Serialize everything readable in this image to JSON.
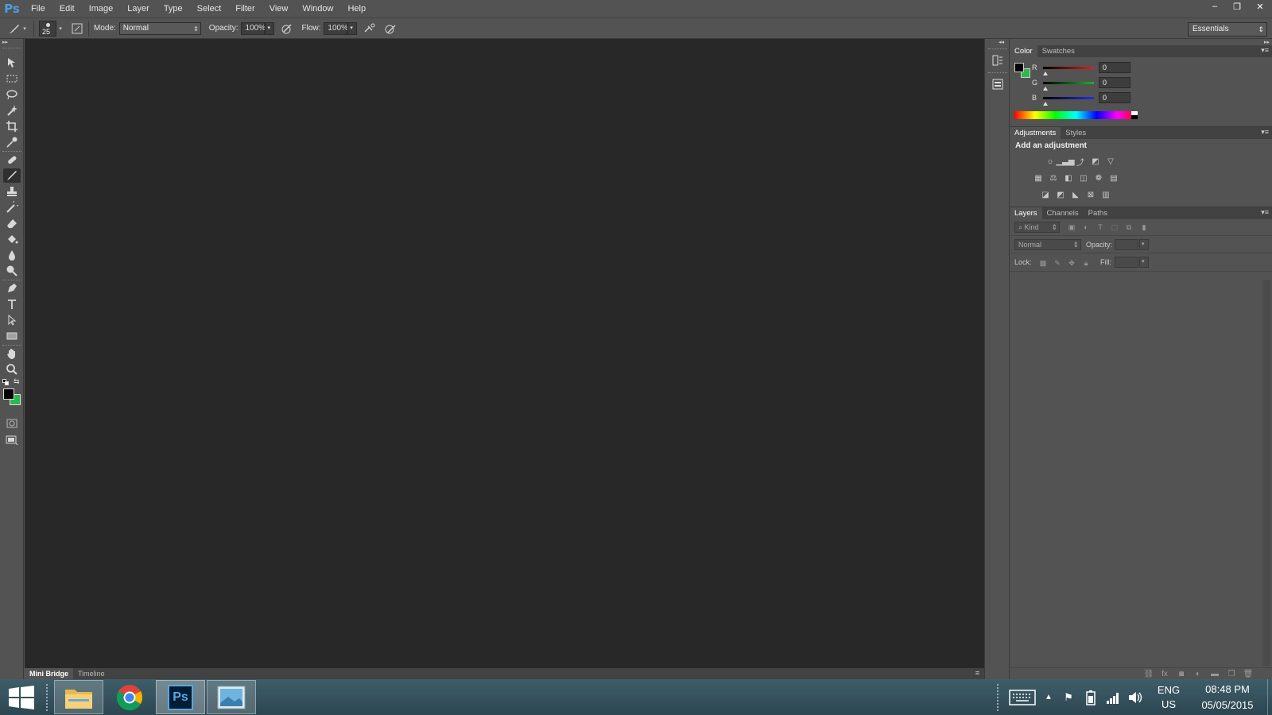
{
  "app": {
    "logo": "Ps",
    "menus": [
      "File",
      "Edit",
      "Image",
      "Layer",
      "Type",
      "Select",
      "Filter",
      "View",
      "Window",
      "Help"
    ],
    "window_controls": {
      "minimize": "–",
      "restore": "❐",
      "close": "✕"
    }
  },
  "options_bar": {
    "brush_size": "25",
    "mode_label": "Mode:",
    "mode_value": "Normal",
    "opacity_label": "Opacity:",
    "opacity_value": "100%",
    "flow_label": "Flow:",
    "flow_value": "100%",
    "workspace": "Essentials"
  },
  "toolbox": {
    "foreground_color": "#000000",
    "background_color": "#2db84d"
  },
  "bottom_panel": {
    "tabs": [
      "Mini Bridge",
      "Timeline"
    ]
  },
  "color_panel": {
    "tabs": [
      "Color",
      "Swatches"
    ],
    "channels": [
      {
        "label": "R",
        "value": "0",
        "color": "#e02020"
      },
      {
        "label": "G",
        "value": "0",
        "color": "#22b02e"
      },
      {
        "label": "B",
        "value": "0",
        "color": "#2030e0"
      }
    ],
    "foreground_color": "#000000",
    "background_color": "#2db84d"
  },
  "adjustments_panel": {
    "tabs": [
      "Adjustments",
      "Styles"
    ],
    "heading": "Add an adjustment"
  },
  "layers_panel": {
    "tabs": [
      "Layers",
      "Channels",
      "Paths"
    ],
    "filter_placeholder": "Kind",
    "blend_mode": "Normal",
    "opacity_label": "Opacity:",
    "lock_label": "Lock:",
    "fill_label": "Fill:"
  },
  "taskbar": {
    "language_top": "ENG",
    "language_bottom": "US",
    "time": "08:48 PM",
    "date": "05/05/2015"
  }
}
